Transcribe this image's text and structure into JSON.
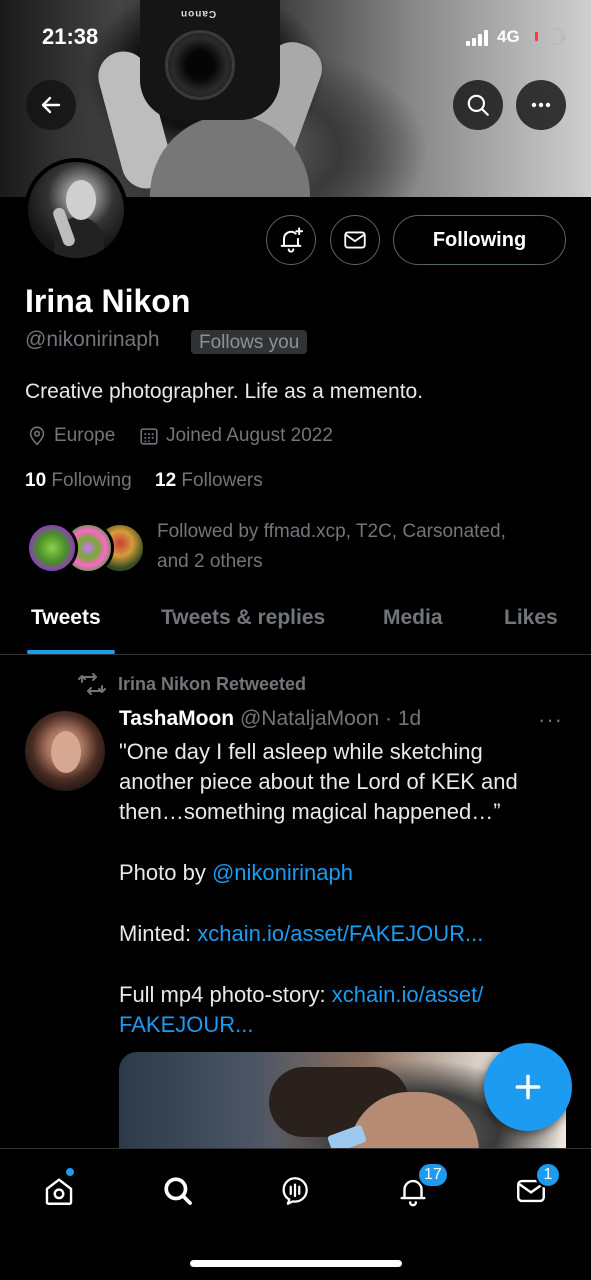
{
  "status_bar": {
    "time": "21:38",
    "network": "4G"
  },
  "banner": {
    "camera_brand": "Canon"
  },
  "profile": {
    "name": "Irina Nikon",
    "handle": "@nikonirinaph",
    "follows_you": "Follows you",
    "bio": "Creative photographer. Life as a memento.",
    "location": "Europe",
    "joined": "Joined August 2022",
    "following_count": "10",
    "following_label": "Following",
    "followers_count": "12",
    "followers_label": "Followers",
    "followed_by_line1": "Followed by ffmad.xcp, T2C, Carsonated,",
    "followed_by_line2": "and 2 others"
  },
  "actions": {
    "following_button": "Following"
  },
  "tabs": [
    {
      "label": "Tweets",
      "active": true
    },
    {
      "label": "Tweets & replies",
      "active": false
    },
    {
      "label": "Media",
      "active": false
    },
    {
      "label": "Likes",
      "active": false
    }
  ],
  "tweet": {
    "retweeted_by": "Irina Nikon Retweeted",
    "author_name": "TashaMoon",
    "author_handle": "@NataljaMoon",
    "time": "· 1d",
    "more": "···",
    "lines": [
      "\"One day I fell asleep while sketching",
      "another piece about the Lord of KEK and",
      "then…something magical happened…”"
    ],
    "photo_by_prefix": "Photo by ",
    "photo_by_link": "@nikonirinaph",
    "minted_prefix": "Minted: ",
    "minted_link": "xchain.io/asset/FAKEJOUR...",
    "mp4_prefix": "Full mp4 photo-story: ",
    "mp4_link_1": "xchain.io/asset/",
    "mp4_link_2": "FAKEJOUR..."
  },
  "bottom_nav": {
    "notifications_badge": "17",
    "messages_badge": "1"
  },
  "colors": {
    "accent": "#1d9bf0",
    "background": "#000000",
    "secondary_text": "#71767b",
    "battery_low": "#ff3b30"
  }
}
